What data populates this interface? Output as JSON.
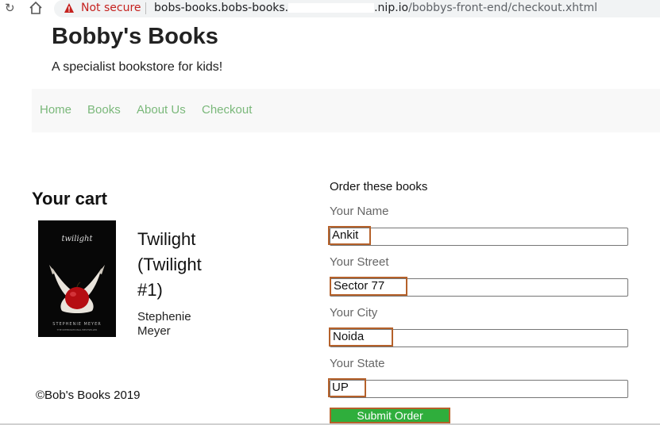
{
  "browser": {
    "security_text": "Not secure",
    "url_prefix": "bobs-books.bobs-books.",
    "url_host_suffix": ".nip.io",
    "url_path": "/bobbys-front-end/checkout.xhtml"
  },
  "site": {
    "title": "Bobby's Books",
    "tagline": "A specialist bookstore for kids!"
  },
  "nav": {
    "items": [
      {
        "label": "Home"
      },
      {
        "label": "Books"
      },
      {
        "label": "About Us"
      },
      {
        "label": "Checkout"
      }
    ]
  },
  "cart": {
    "heading": "Your cart",
    "book": {
      "title": "Twilight (Twilight #1)",
      "author": "Stephenie Meyer",
      "cover_title": "twilight",
      "cover_author": "STEPHENIE MEYER",
      "cover_blurb": "THE INTERNATIONAL BESTSELLER"
    }
  },
  "order_form": {
    "heading": "Order these books",
    "fields": [
      {
        "label": "Your Name",
        "value": "Ankit"
      },
      {
        "label": "Your Street",
        "value": "Sector 77"
      },
      {
        "label": "Your City",
        "value": "Noida"
      },
      {
        "label": "Your State",
        "value": "UP"
      }
    ],
    "submit_label": "Submit Order"
  },
  "footer": {
    "text": "©Bob's Books 2019"
  },
  "colors": {
    "nav_link": "#7ab87a",
    "submit_bg": "#2fae3c",
    "highlight_border": "#b5612a",
    "warning_red": "#c5221f"
  }
}
